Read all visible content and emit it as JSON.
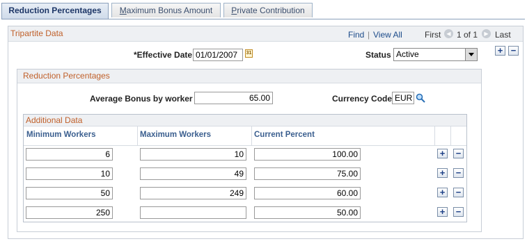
{
  "tabs": [
    {
      "label": "Reduction Percentages",
      "active": true
    },
    {
      "label": "Maximum Bonus Amount",
      "access_key": "M",
      "rest": "aximum Bonus Amount"
    },
    {
      "label": "Private Contribution",
      "access_key": "P",
      "rest": "rivate Contribution"
    }
  ],
  "tripartite": {
    "title": "Tripartite Data",
    "find": "Find",
    "sep": "|",
    "view_all": "View All",
    "first": "First",
    "range": "1 of 1",
    "last": "Last"
  },
  "effective_date": {
    "label": "*Effective Date",
    "value": "01/01/2007"
  },
  "status": {
    "label": "Status",
    "value": "Active"
  },
  "reduction": {
    "title": "Reduction Percentages",
    "avg_bonus_label": "Average Bonus by worker",
    "avg_bonus_value": "65.00",
    "currency_label": "Currency Code",
    "currency_value": "EUR"
  },
  "additional": {
    "title": "Additional Data",
    "columns": [
      "Minimum Workers",
      "Maximum Workers",
      "Current Percent"
    ],
    "rows": [
      {
        "min": "6",
        "max": "10",
        "pct": "100.00"
      },
      {
        "min": "10",
        "max": "49",
        "pct": "75.00"
      },
      {
        "min": "50",
        "max": "249",
        "pct": "60.00"
      },
      {
        "min": "250",
        "max": "",
        "pct": "50.00"
      }
    ]
  },
  "icons": {
    "add": "+",
    "remove": "−",
    "prev": "◀",
    "next": "▶",
    "calendar": "31"
  }
}
